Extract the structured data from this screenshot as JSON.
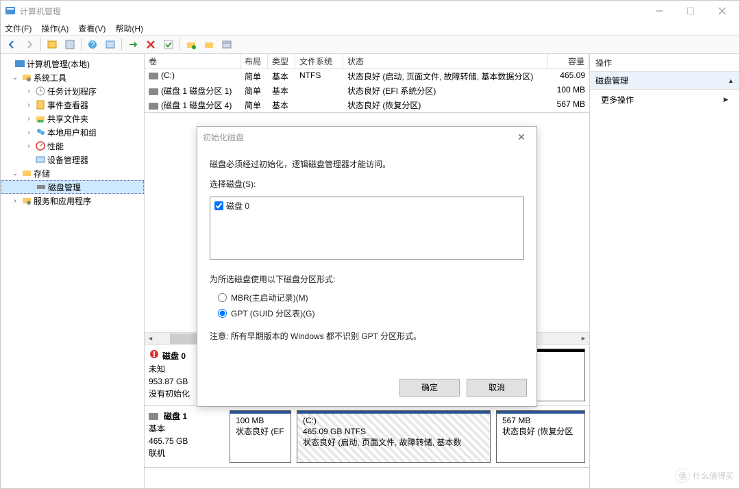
{
  "window": {
    "title": "计算机管理"
  },
  "menu": {
    "file": "文件(F)",
    "action": "操作(A)",
    "view": "查看(V)",
    "help": "帮助(H)"
  },
  "tree": {
    "root": "计算机管理(本地)",
    "system_tools": "系统工具",
    "task_scheduler": "任务计划程序",
    "event_viewer": "事件查看器",
    "shared_folders": "共享文件夹",
    "local_users": "本地用户和组",
    "performance": "性能",
    "device_manager": "设备管理器",
    "storage": "存储",
    "disk_mgmt": "磁盘管理",
    "services_apps": "服务和应用程序"
  },
  "columns": {
    "volume": "卷",
    "layout": "布局",
    "type": "类型",
    "filesystem": "文件系统",
    "status": "状态",
    "capacity": "容量"
  },
  "volumes": [
    {
      "name": "(C:)",
      "layout": "简单",
      "type": "基本",
      "fs": "NTFS",
      "status": "状态良好 (启动, 页面文件, 故障转储, 基本数据分区)",
      "cap": "465.09"
    },
    {
      "name": "(磁盘 1 磁盘分区 1)",
      "layout": "简单",
      "type": "基本",
      "fs": "",
      "status": "状态良好 (EFI 系统分区)",
      "cap": "100 MB"
    },
    {
      "name": "(磁盘 1 磁盘分区 4)",
      "layout": "简单",
      "type": "基本",
      "fs": "",
      "status": "状态良好 (恢复分区)",
      "cap": "567 MB"
    }
  ],
  "disk0": {
    "name": "磁盘 0",
    "status": "未知",
    "size": "953.87 GB",
    "init": "没有初始化"
  },
  "disk1": {
    "name": "磁盘 1",
    "type": "基本",
    "size": "465.75 GB",
    "online": "联机",
    "parts": [
      {
        "label": "",
        "size": "100 MB",
        "status": "状态良好 (EF"
      },
      {
        "label": "(C:)",
        "size": "465.09 GB NTFS",
        "status": "状态良好 (启动, 页面文件, 故障转储, 基本数"
      },
      {
        "label": "",
        "size": "567 MB",
        "status": "状态良好 (恢复分区"
      }
    ]
  },
  "actions": {
    "header": "操作",
    "disk_mgmt": "磁盘管理",
    "more": "更多操作"
  },
  "dialog": {
    "title": "初始化磁盘",
    "msg": "磁盘必须经过初始化，逻辑磁盘管理器才能访问。",
    "select_label": "选择磁盘(S):",
    "disk_option": "磁盘 0",
    "partition_label": "为所选磁盘使用以下磁盘分区形式:",
    "mbr": "MBR(主启动记录)(M)",
    "gpt": "GPT (GUID 分区表)(G)",
    "note": "注意: 所有早期版本的 Windows 都不识别 GPT 分区形式。",
    "ok": "确定",
    "cancel": "取消"
  },
  "watermark": "什么值得买"
}
